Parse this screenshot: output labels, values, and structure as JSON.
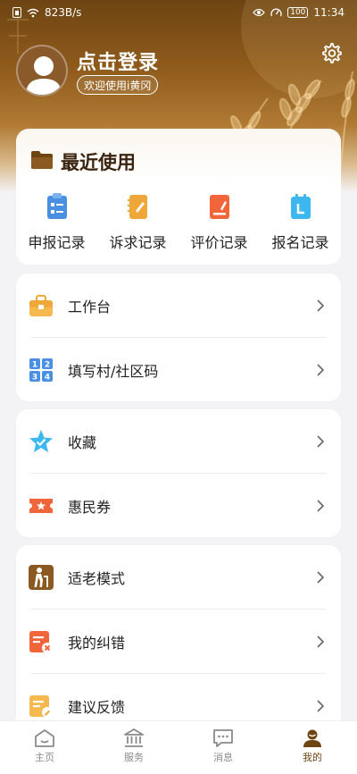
{
  "status_bar": {
    "network_speed": "823B/s",
    "battery": "100",
    "time": "11:34"
  },
  "profile": {
    "login_prompt": "点击登录",
    "welcome": "欢迎使用i黄冈"
  },
  "recent": {
    "title": "最近使用",
    "items": [
      {
        "label": "申报记录",
        "icon": "declare-record-icon",
        "color": "#4a90e2"
      },
      {
        "label": "诉求记录",
        "icon": "appeal-record-icon",
        "color": "#f0a73a"
      },
      {
        "label": "评价记录",
        "icon": "evaluation-record-icon",
        "color": "#f0663a"
      },
      {
        "label": "报名记录",
        "icon": "signup-record-icon",
        "color": "#3cb7f0"
      }
    ]
  },
  "menu_groups": [
    {
      "items": [
        {
          "label": "工作台",
          "icon": "briefcase-icon"
        },
        {
          "label": "填写村/社区码",
          "icon": "number-grid-icon"
        }
      ]
    },
    {
      "items": [
        {
          "label": "收藏",
          "icon": "star-icon"
        },
        {
          "label": "惠民券",
          "icon": "coupon-icon"
        }
      ]
    },
    {
      "items": [
        {
          "label": "适老模式",
          "icon": "elderly-mode-icon"
        },
        {
          "label": "我的纠错",
          "icon": "correction-icon"
        },
        {
          "label": "建议反馈",
          "icon": "feedback-icon"
        }
      ]
    }
  ],
  "tabbar": [
    {
      "label": "主页",
      "icon": "home-icon"
    },
    {
      "label": "服务",
      "icon": "service-icon"
    },
    {
      "label": "消息",
      "icon": "message-icon"
    },
    {
      "label": "我的",
      "icon": "profile-icon",
      "active": true
    }
  ],
  "colors": {
    "brand": "#6d4412",
    "accent_orange": "#f0a73a",
    "page_bg": "#f3f3f5"
  }
}
